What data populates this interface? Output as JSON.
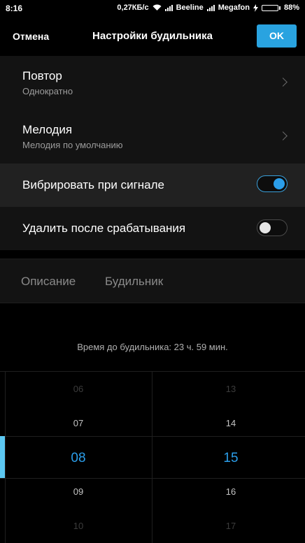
{
  "status_bar": {
    "time": "8:16",
    "speed": "0,27КБ/с",
    "carrier1": "Beeline",
    "carrier2": "Megafon",
    "battery": "88%",
    "battery_level": 0.88
  },
  "header": {
    "cancel_label": "Отмена",
    "title": "Настройки будильника",
    "ok_label": "OK"
  },
  "settings": {
    "repeat": {
      "label": "Повтор",
      "value": "Однократно"
    },
    "melody": {
      "label": "Мелодия",
      "value": "Мелодия по умолчанию"
    },
    "vibrate": {
      "label": "Вибрировать при сигнале",
      "on": true
    },
    "delete_after": {
      "label": "Удалить после срабатывания",
      "on": false
    }
  },
  "tabs": {
    "description": "Описание",
    "alarm": "Будильник"
  },
  "remaining": "Время до будильника: 23 ч. 59 мин.",
  "picker": {
    "hours": [
      "06",
      "07",
      "08",
      "09",
      "10"
    ],
    "minutes": [
      "13",
      "14",
      "15",
      "16",
      "17"
    ],
    "selected_hour": "08",
    "selected_minute": "15"
  },
  "colors": {
    "accent": "#2b9eea",
    "ok_button": "#29a3e0",
    "battery": "#4cd964"
  }
}
